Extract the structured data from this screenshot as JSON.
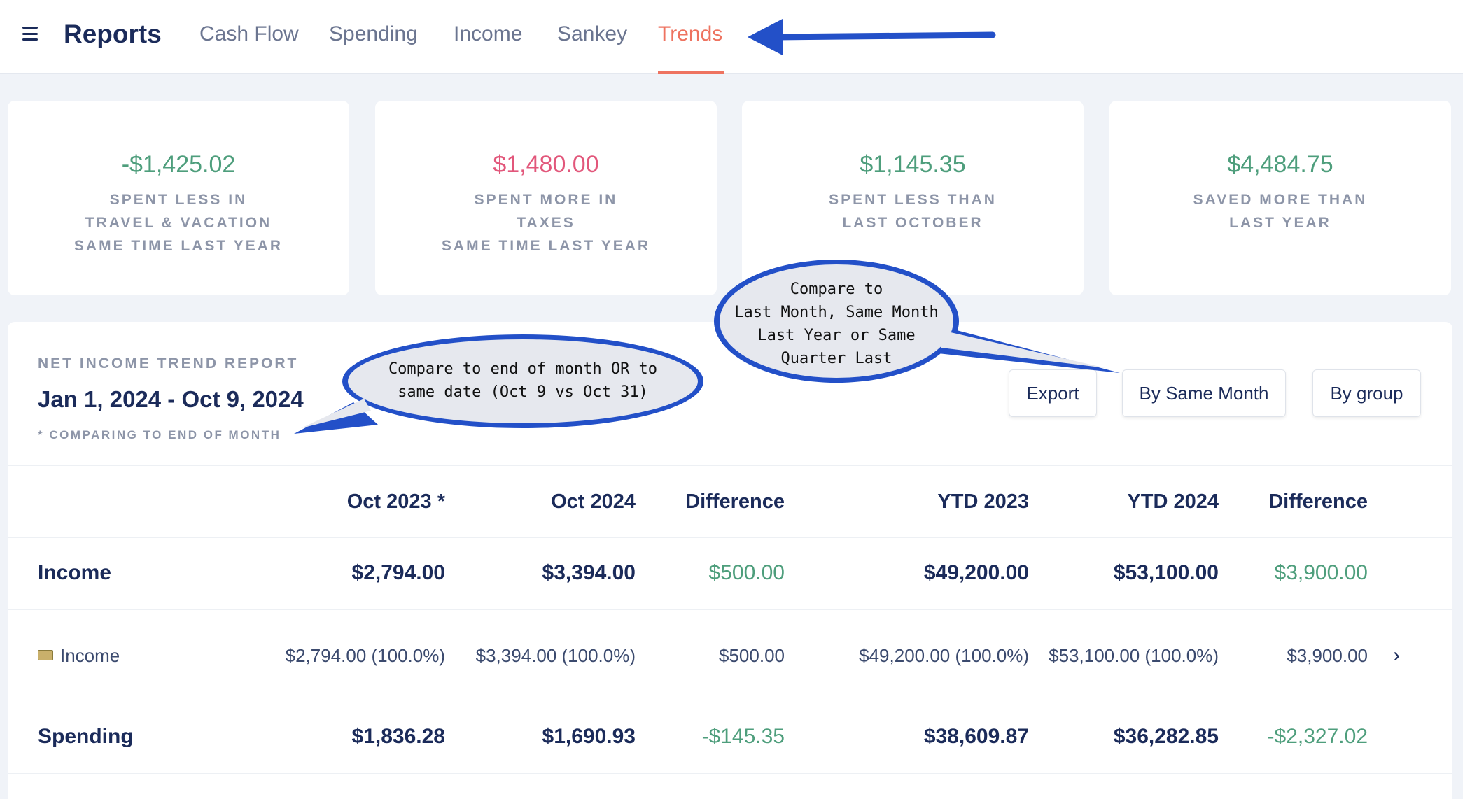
{
  "nav": {
    "title": "Reports",
    "tabs": [
      {
        "label": "Cash Flow"
      },
      {
        "label": "Spending"
      },
      {
        "label": "Income"
      },
      {
        "label": "Sankey"
      },
      {
        "label": "Trends",
        "active": true
      }
    ]
  },
  "cards": [
    {
      "amount": "-$1,425.02",
      "lines": [
        "SPENT LESS IN",
        "TRAVEL & VACATION",
        "SAME TIME LAST YEAR"
      ],
      "color": "#4e9e7c"
    },
    {
      "amount": "$1,480.00",
      "lines": [
        "SPENT MORE IN",
        "TAXES",
        "SAME TIME LAST YEAR"
      ],
      "color": "#e2577b"
    },
    {
      "amount": "$1,145.35",
      "lines": [
        "SPENT LESS THAN",
        "LAST OCTOBER"
      ],
      "color": "#4e9e7c"
    },
    {
      "amount": "$4,484.75",
      "lines": [
        "SAVED MORE THAN",
        "LAST YEAR"
      ],
      "color": "#4e9e7c"
    }
  ],
  "report": {
    "label": "NET INCOME TREND REPORT",
    "range": "Jan 1, 2024 - Oct 9, 2024",
    "note": "* COMPARING TO END OF MONTH",
    "buttons": {
      "export": "Export",
      "by_same_month": "By Same Month",
      "by_group": "By group"
    }
  },
  "table": {
    "headers": [
      "Oct 2023 *",
      "Oct 2024",
      "Difference",
      "YTD 2023",
      "YTD 2024",
      "Difference"
    ],
    "rows": [
      {
        "label": "Income",
        "values": [
          "$2,794.00",
          "$3,394.00",
          "$500.00",
          "$49,200.00",
          "$53,100.00",
          "$3,900.00"
        ]
      },
      {
        "label": "Income",
        "icon": "money-icon",
        "values": [
          "$2,794.00 (100.0%)",
          "$3,394.00 (100.0%)",
          "$500.00",
          "$49,200.00 (100.0%)",
          "$53,100.00 (100.0%)",
          "$3,900.00"
        ]
      },
      {
        "label": "Spending",
        "values": [
          "$1,836.28",
          "$1,690.93",
          "-$145.35",
          "$38,609.87",
          "$36,282.85",
          "-$2,327.02"
        ]
      }
    ]
  },
  "annotations": {
    "bubble1": [
      "Compare to end of month OR to",
      "same date (Oct 9 vs Oct 31)"
    ],
    "bubble2": [
      "Compare to",
      "Last Month, Same Month",
      "Last Year or Same",
      "Quarter Last"
    ]
  },
  "colors": {
    "accent": "#ee7360",
    "positive": "#4e9e7c",
    "negative": "#e2577b",
    "annotation": "#2350c8"
  }
}
